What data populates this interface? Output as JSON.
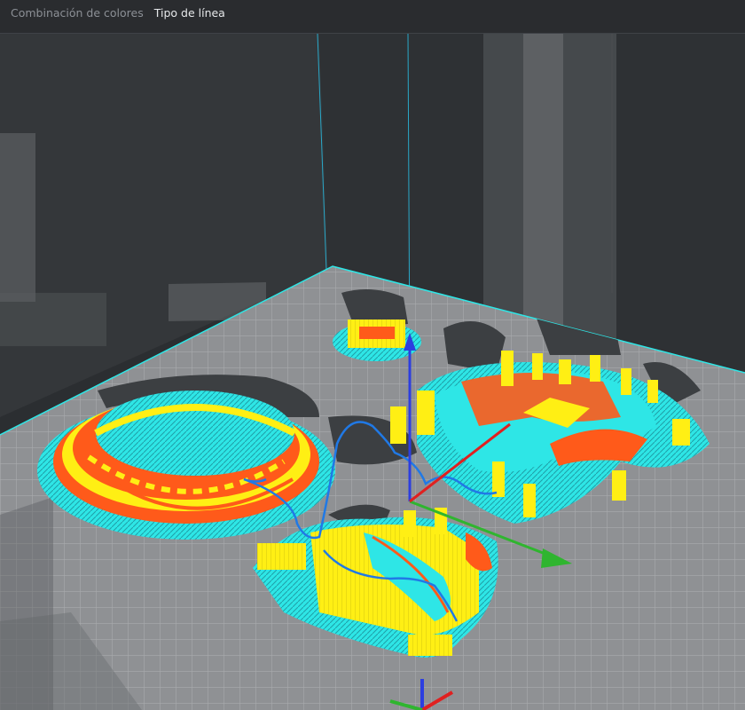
{
  "tabs": [
    {
      "label": "Combinación de colores",
      "active": false
    },
    {
      "label": "Tipo de línea",
      "active": true
    }
  ],
  "colors": {
    "background": "#2b2e31",
    "bed": "#8f9194",
    "grid": "#a9abad",
    "outer_wall": "#ff5a1a",
    "inner_wall": "#ffef14",
    "infill": "#2ee6e6",
    "skirt": "#2ee6e6",
    "travel": "#2079e6",
    "axis_x": "#e02020",
    "axis_y": "#2fb52f",
    "axis_z": "#2c3ee0",
    "support_shadow": "#3c3f42"
  },
  "icons": {
    "axis_gizmo": "xyz-axes-icon"
  }
}
